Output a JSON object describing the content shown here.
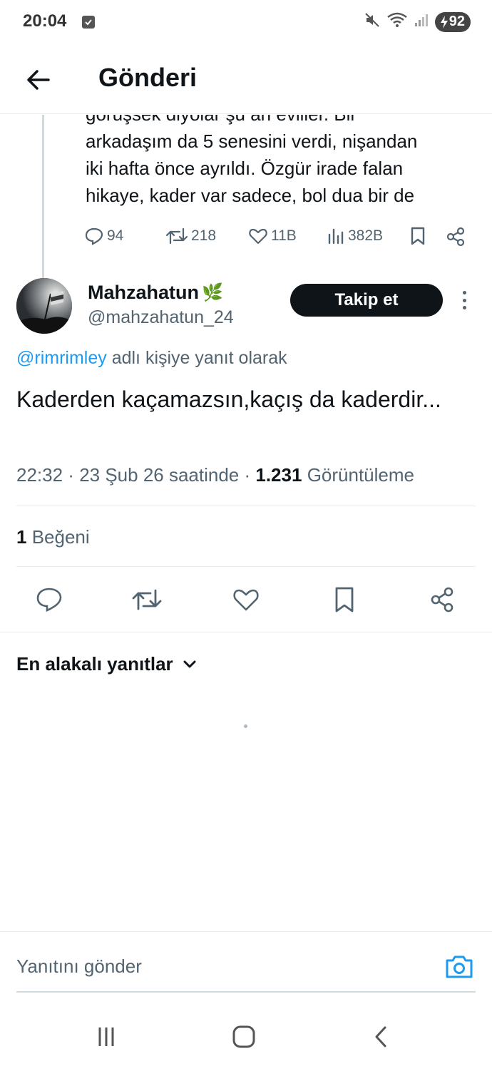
{
  "status_bar": {
    "time": "20:04",
    "battery": "92",
    "icons": [
      "notification-check-icon",
      "mute-icon",
      "wifi-icon",
      "signal-icon",
      "battery-charging-icon"
    ]
  },
  "header": {
    "title": "Gönderi",
    "back_icon": "arrow-left-icon"
  },
  "parent_post": {
    "text_lines": [
      "görüşsek diyolar şu an evliler. Bir",
      "arkadaşım da 5 senesini verdi, nişandan",
      "iki hafta önce ayrıldı.  Özgür irade falan",
      "hikaye, kader var sadece, bol dua bir de"
    ],
    "replies": "94",
    "reposts": "218",
    "likes": "11B",
    "views": "382B"
  },
  "post": {
    "author_name": "Mahzahatun",
    "author_emoji": "🌿",
    "author_handle": "@mahzahatun_24",
    "follow_label": "Takip et",
    "reply_to_handle": "@rimrimley",
    "reply_to_suffix": " adlı kişiye yanıt olarak",
    "text": "Kaderden kaçamazsın,kaçış da kaderdir...",
    "time": "22:32",
    "date": "23 Şub 26 saatinde",
    "views_count": "1.231",
    "views_label": "Görüntüleme",
    "likes_count": "1",
    "likes_label": "Beğeni"
  },
  "replies_sort": {
    "label": "En alakalı yanıtlar"
  },
  "compose": {
    "placeholder": "Yanıtını gönder"
  },
  "colors": {
    "accent": "#1d9bf0",
    "text_primary": "#0f1419",
    "text_secondary": "#536471",
    "divider": "#e6ecf0",
    "follow_bg": "#0f1419"
  }
}
